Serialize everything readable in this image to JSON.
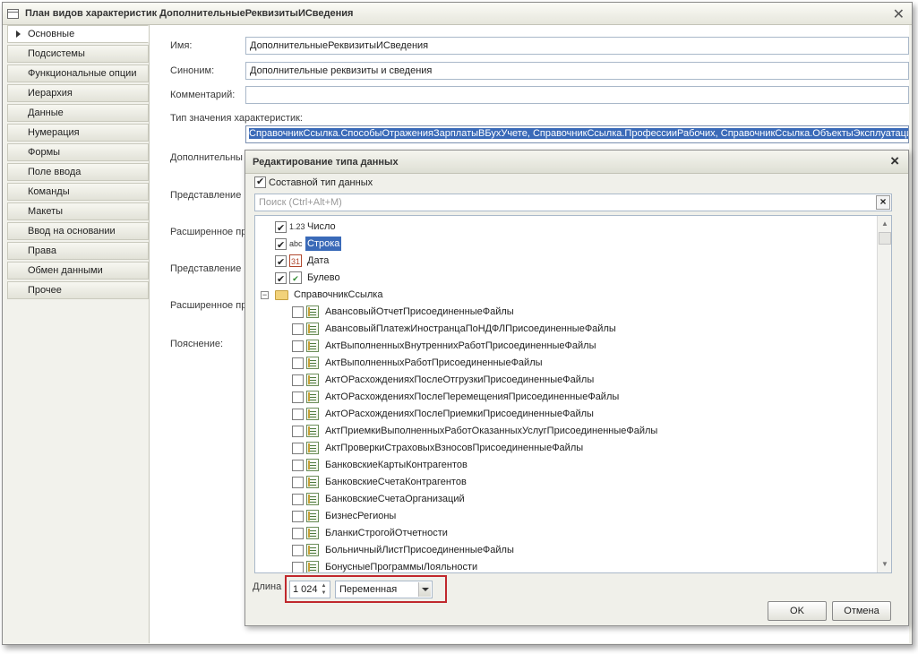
{
  "window": {
    "title": "План видов характеристик ДополнительныеРеквизитыИСведения"
  },
  "nav": {
    "items": [
      {
        "label": "Основные",
        "active": true
      },
      {
        "label": "Подсистемы"
      },
      {
        "label": "Функциональные опции"
      },
      {
        "label": "Иерархия"
      },
      {
        "label": "Данные"
      },
      {
        "label": "Нумерация"
      },
      {
        "label": "Формы"
      },
      {
        "label": "Поле ввода"
      },
      {
        "label": "Команды"
      },
      {
        "label": "Макеты"
      },
      {
        "label": "Ввод на основании"
      },
      {
        "label": "Права"
      },
      {
        "label": "Обмен данными"
      },
      {
        "label": "Прочее"
      }
    ]
  },
  "form": {
    "name_label": "Имя:",
    "name_value": "ДополнительныеРеквизитыИСведения",
    "synonym_label": "Синоним:",
    "synonym_value": "Дополнительные реквизиты и сведения",
    "comment_label": "Комментарий:",
    "comment_value": "",
    "type_label": "Тип значения характеристик:",
    "type_value": "СправочникСсылка.СпособыОтраженияЗарплатыВБухУчете, СправочникСсылка.ПрофессииРабочих, СправочникСсылка.ОбъектыЭксплуатации",
    "additional_label": "Дополнительны",
    "representation1_label": "Представление",
    "extended1_label": "Расширенное пр",
    "representation2_label": "Представление",
    "extended2_label": "Расширенное пр",
    "explanation_label": "Пояснение:"
  },
  "dialog": {
    "title": "Редактирование типа данных",
    "composite_label": "Составной тип данных",
    "composite_checked": true,
    "search_placeholder": "Поиск (Ctrl+Alt+M)",
    "primitive_types": [
      {
        "label": "Число",
        "checked": true,
        "icon": "number-icon",
        "icon_text": "1.23"
      },
      {
        "label": "Строка",
        "checked": true,
        "icon": "string-icon",
        "icon_text": "abc",
        "selected": true
      },
      {
        "label": "Дата",
        "checked": true,
        "icon": "date-icon",
        "icon_text": "31"
      },
      {
        "label": "Булево",
        "checked": true,
        "icon": "boolean-icon",
        "icon_text": "✔"
      }
    ],
    "group_label": "СправочникСсылка",
    "group_expander": "−",
    "ref_types": [
      {
        "label": "АвансовыйОтчетПрисоединенныеФайлы",
        "checked": false
      },
      {
        "label": "АвансовыйПлатежИностранцаПоНДФЛПрисоединенныеФайлы",
        "checked": false
      },
      {
        "label": "АктВыполненныхВнутреннихРаботПрисоединенныеФайлы",
        "checked": false
      },
      {
        "label": "АктВыполненныхРаботПрисоединенныеФайлы",
        "checked": false
      },
      {
        "label": "АктОРасхожденияхПослеОтгрузкиПрисоединенныеФайлы",
        "checked": false
      },
      {
        "label": "АктОРасхожденияхПослеПеремещенияПрисоединенныеФайлы",
        "checked": false
      },
      {
        "label": "АктОРасхожденияхПослеПриемкиПрисоединенныеФайлы",
        "checked": false
      },
      {
        "label": "АктПриемкиВыполненныхРаботОказанныхУслугПрисоединенныеФайлы",
        "checked": false
      },
      {
        "label": "АктПроверкиСтраховыхВзносовПрисоединенныеФайлы",
        "checked": false
      },
      {
        "label": "БанковскиеКартыКонтрагентов",
        "checked": false
      },
      {
        "label": "БанковскиеСчетаКонтрагентов",
        "checked": false
      },
      {
        "label": "БанковскиеСчетаОрганизаций",
        "checked": false
      },
      {
        "label": "БизнесРегионы",
        "checked": false
      },
      {
        "label": "БланкиСтрогойОтчетности",
        "checked": false
      },
      {
        "label": "БольничныйЛистПрисоединенныеФайлы",
        "checked": false
      },
      {
        "label": "БонусныеПрограммыЛояльности",
        "checked": false
      }
    ],
    "length_label": "Длина",
    "length_value": "1 024",
    "length_mode": "Переменная",
    "ok_label": "OK",
    "cancel_label": "Отмена"
  }
}
